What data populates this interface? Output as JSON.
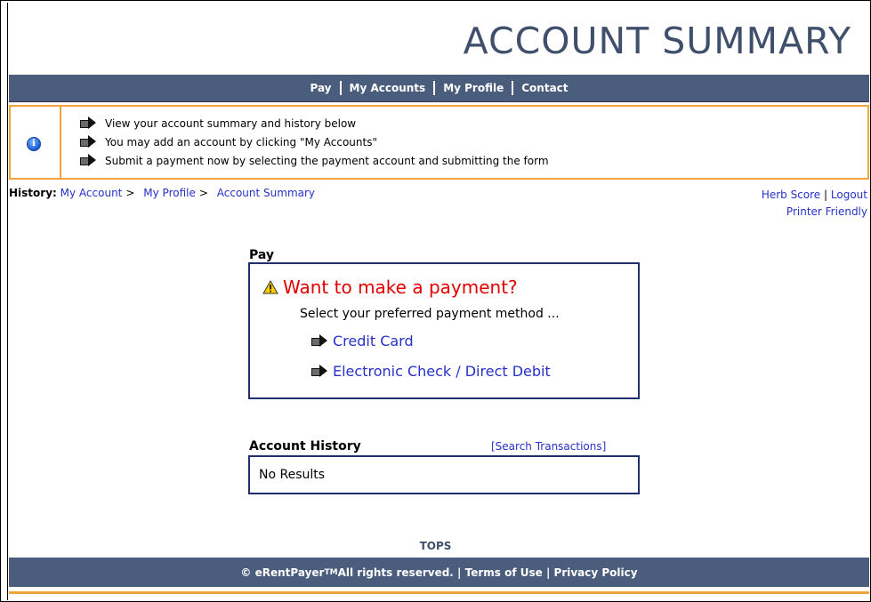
{
  "header": {
    "title": "ACCOUNT SUMMARY"
  },
  "nav": {
    "items": [
      "Pay",
      "My Accounts",
      "My Profile",
      "Contact"
    ]
  },
  "info": {
    "icon": "info-icon",
    "lines": [
      "View your account summary and history below",
      "You may add an account by clicking \"My Accounts\"",
      "Submit a payment now by selecting the payment account and submitting the form"
    ]
  },
  "history": {
    "label": "History:",
    "crumbs": [
      "My Account",
      "My Profile",
      "Account Summary"
    ],
    "separator": ">"
  },
  "user_links": {
    "name": "Herb Score",
    "sep": "|",
    "logout": "Logout",
    "printer": "Printer Friendly"
  },
  "pay": {
    "label": "Pay",
    "heading": "Want to make a payment?",
    "subtext": "Select your preferred payment method ...",
    "options": [
      "Credit Card",
      "Electronic Check / Direct Debit"
    ]
  },
  "account_history": {
    "label": "Account History",
    "search_link": "[Search Transactions]",
    "empty": "No Results"
  },
  "tops": "TOPS",
  "footer": {
    "copyright": "© eRentPayer",
    "tm": "TM",
    "rights": " All rights reserved.",
    "sep": "|",
    "terms": "Terms of Use",
    "privacy": "Privacy Policy"
  },
  "colors": {
    "nav_bg": "#4a5d7c",
    "accent_orange": "#f2a33c",
    "link": "#2631c7",
    "heading_red": "#e00000",
    "box_border": "#1f2f6c"
  }
}
